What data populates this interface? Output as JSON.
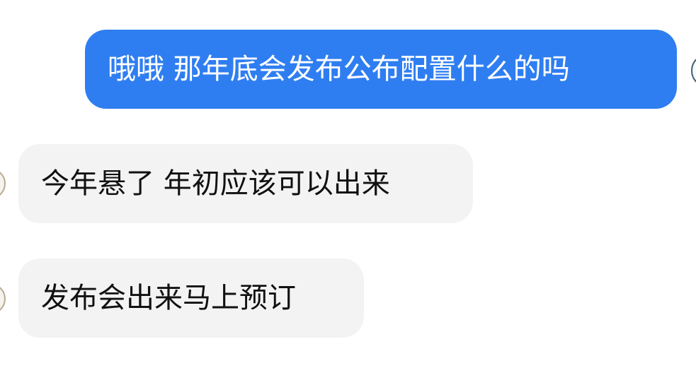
{
  "conversation": {
    "messages": [
      {
        "direction": "outgoing",
        "text": "哦哦 那年底会发布公布配置什么的吗"
      },
      {
        "direction": "incoming",
        "text": "今年悬了 年初应该可以出来"
      },
      {
        "direction": "incoming",
        "text": "发布会出来马上预订"
      }
    ]
  },
  "colors": {
    "outgoing_bubble": "#2f7ef1",
    "incoming_bubble": "#f3f3f3",
    "outgoing_text": "#ffffff",
    "incoming_text": "#111111"
  },
  "icons": {
    "self_avatar": "avatar",
    "peer_avatar": "avatar"
  }
}
